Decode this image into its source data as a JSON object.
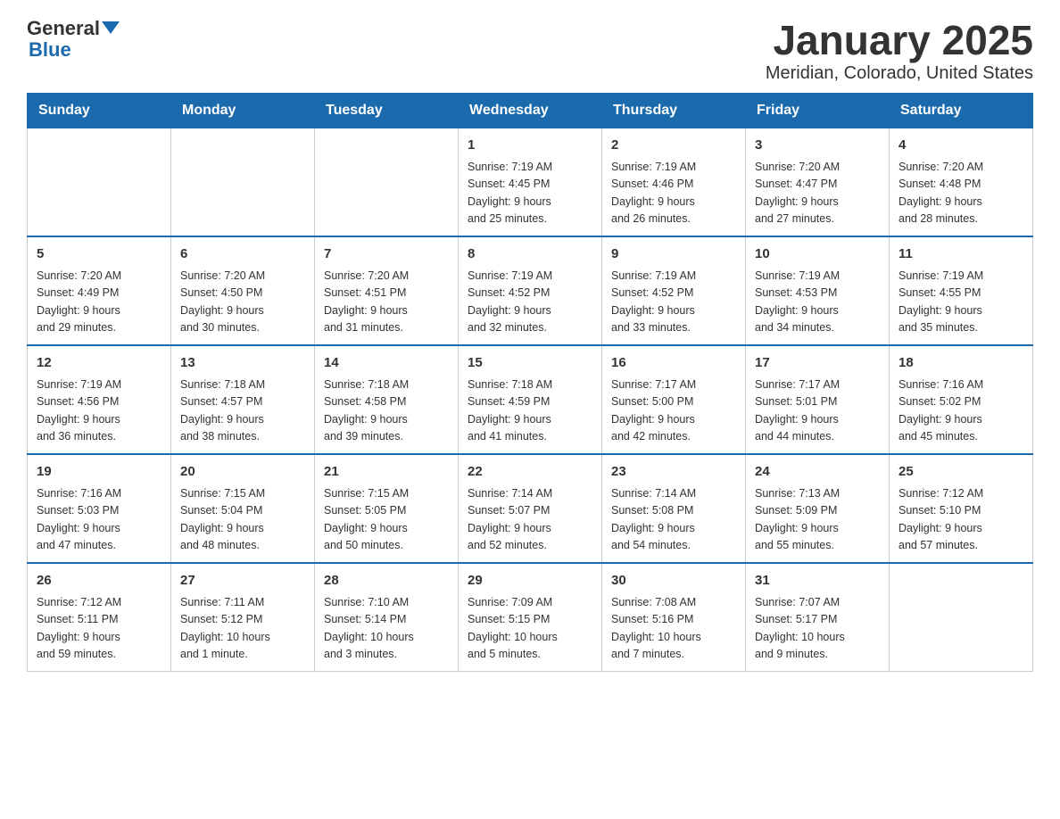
{
  "logo": {
    "general": "General",
    "triangle_color": "#1a6aad",
    "blue": "Blue"
  },
  "title": "January 2025",
  "subtitle": "Meridian, Colorado, United States",
  "days_of_week": [
    "Sunday",
    "Monday",
    "Tuesday",
    "Wednesday",
    "Thursday",
    "Friday",
    "Saturday"
  ],
  "weeks": [
    [
      {
        "day": "",
        "info": ""
      },
      {
        "day": "",
        "info": ""
      },
      {
        "day": "",
        "info": ""
      },
      {
        "day": "1",
        "info": "Sunrise: 7:19 AM\nSunset: 4:45 PM\nDaylight: 9 hours\nand 25 minutes."
      },
      {
        "day": "2",
        "info": "Sunrise: 7:19 AM\nSunset: 4:46 PM\nDaylight: 9 hours\nand 26 minutes."
      },
      {
        "day": "3",
        "info": "Sunrise: 7:20 AM\nSunset: 4:47 PM\nDaylight: 9 hours\nand 27 minutes."
      },
      {
        "day": "4",
        "info": "Sunrise: 7:20 AM\nSunset: 4:48 PM\nDaylight: 9 hours\nand 28 minutes."
      }
    ],
    [
      {
        "day": "5",
        "info": "Sunrise: 7:20 AM\nSunset: 4:49 PM\nDaylight: 9 hours\nand 29 minutes."
      },
      {
        "day": "6",
        "info": "Sunrise: 7:20 AM\nSunset: 4:50 PM\nDaylight: 9 hours\nand 30 minutes."
      },
      {
        "day": "7",
        "info": "Sunrise: 7:20 AM\nSunset: 4:51 PM\nDaylight: 9 hours\nand 31 minutes."
      },
      {
        "day": "8",
        "info": "Sunrise: 7:19 AM\nSunset: 4:52 PM\nDaylight: 9 hours\nand 32 minutes."
      },
      {
        "day": "9",
        "info": "Sunrise: 7:19 AM\nSunset: 4:52 PM\nDaylight: 9 hours\nand 33 minutes."
      },
      {
        "day": "10",
        "info": "Sunrise: 7:19 AM\nSunset: 4:53 PM\nDaylight: 9 hours\nand 34 minutes."
      },
      {
        "day": "11",
        "info": "Sunrise: 7:19 AM\nSunset: 4:55 PM\nDaylight: 9 hours\nand 35 minutes."
      }
    ],
    [
      {
        "day": "12",
        "info": "Sunrise: 7:19 AM\nSunset: 4:56 PM\nDaylight: 9 hours\nand 36 minutes."
      },
      {
        "day": "13",
        "info": "Sunrise: 7:18 AM\nSunset: 4:57 PM\nDaylight: 9 hours\nand 38 minutes."
      },
      {
        "day": "14",
        "info": "Sunrise: 7:18 AM\nSunset: 4:58 PM\nDaylight: 9 hours\nand 39 minutes."
      },
      {
        "day": "15",
        "info": "Sunrise: 7:18 AM\nSunset: 4:59 PM\nDaylight: 9 hours\nand 41 minutes."
      },
      {
        "day": "16",
        "info": "Sunrise: 7:17 AM\nSunset: 5:00 PM\nDaylight: 9 hours\nand 42 minutes."
      },
      {
        "day": "17",
        "info": "Sunrise: 7:17 AM\nSunset: 5:01 PM\nDaylight: 9 hours\nand 44 minutes."
      },
      {
        "day": "18",
        "info": "Sunrise: 7:16 AM\nSunset: 5:02 PM\nDaylight: 9 hours\nand 45 minutes."
      }
    ],
    [
      {
        "day": "19",
        "info": "Sunrise: 7:16 AM\nSunset: 5:03 PM\nDaylight: 9 hours\nand 47 minutes."
      },
      {
        "day": "20",
        "info": "Sunrise: 7:15 AM\nSunset: 5:04 PM\nDaylight: 9 hours\nand 48 minutes."
      },
      {
        "day": "21",
        "info": "Sunrise: 7:15 AM\nSunset: 5:05 PM\nDaylight: 9 hours\nand 50 minutes."
      },
      {
        "day": "22",
        "info": "Sunrise: 7:14 AM\nSunset: 5:07 PM\nDaylight: 9 hours\nand 52 minutes."
      },
      {
        "day": "23",
        "info": "Sunrise: 7:14 AM\nSunset: 5:08 PM\nDaylight: 9 hours\nand 54 minutes."
      },
      {
        "day": "24",
        "info": "Sunrise: 7:13 AM\nSunset: 5:09 PM\nDaylight: 9 hours\nand 55 minutes."
      },
      {
        "day": "25",
        "info": "Sunrise: 7:12 AM\nSunset: 5:10 PM\nDaylight: 9 hours\nand 57 minutes."
      }
    ],
    [
      {
        "day": "26",
        "info": "Sunrise: 7:12 AM\nSunset: 5:11 PM\nDaylight: 9 hours\nand 59 minutes."
      },
      {
        "day": "27",
        "info": "Sunrise: 7:11 AM\nSunset: 5:12 PM\nDaylight: 10 hours\nand 1 minute."
      },
      {
        "day": "28",
        "info": "Sunrise: 7:10 AM\nSunset: 5:14 PM\nDaylight: 10 hours\nand 3 minutes."
      },
      {
        "day": "29",
        "info": "Sunrise: 7:09 AM\nSunset: 5:15 PM\nDaylight: 10 hours\nand 5 minutes."
      },
      {
        "day": "30",
        "info": "Sunrise: 7:08 AM\nSunset: 5:16 PM\nDaylight: 10 hours\nand 7 minutes."
      },
      {
        "day": "31",
        "info": "Sunrise: 7:07 AM\nSunset: 5:17 PM\nDaylight: 10 hours\nand 9 minutes."
      },
      {
        "day": "",
        "info": ""
      }
    ]
  ]
}
